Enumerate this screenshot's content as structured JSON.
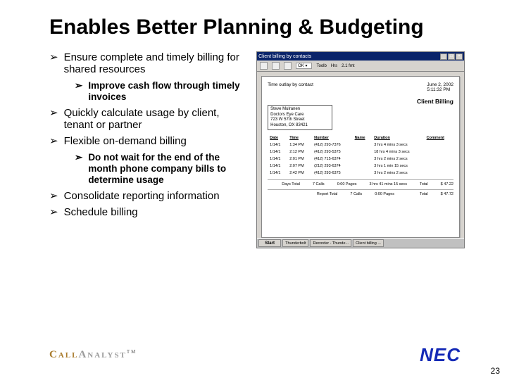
{
  "title": "Enables Better Planning & Budgeting",
  "bullets": {
    "b1": "Ensure complete and timely billing for shared resources",
    "b1_sub1": "Improve cash flow through timely invoices",
    "b2": "Quickly calculate usage by client, tenant or partner",
    "b3": "Flexible on-demand billing",
    "b3_sub1": "Do not wait for the end of the month phone company bills to determine usage",
    "b4": "Consolidate reporting information",
    "b5": "Schedule billing"
  },
  "screenshot": {
    "title": "Client billing by contacts",
    "toolbar": {
      "ok": "OK",
      "tb1": "Toolb",
      "tb2": "Hrs",
      "tb3": "2.1 fmt"
    },
    "paper": {
      "head_left": "Time outlay by contact",
      "head_right_date": "June 2, 2002",
      "head_right_time": "5:11:32 PM",
      "report_title": "Client Billing",
      "client_l1": "Steve Mulranen",
      "client_l2": "Doctors Eye Care",
      "client_l3": "723 W 57th Street",
      "client_l4": "Houston, OX 83421",
      "cols": {
        "c1": "Date",
        "c2": "Time",
        "c3": "Number",
        "c4": "Name",
        "c5": "Duration",
        "c6": "Comment"
      },
      "rows": [
        [
          "1/14/1",
          "1:34 PM",
          "(412) 293-7376",
          "",
          "3 hrs 4 mins 3 secs",
          ""
        ],
        [
          "1/14/1",
          "2:12 PM",
          "(412) 293-5375",
          "",
          "18 hrs 4 mins 3 secs",
          ""
        ],
        [
          "1/14/1",
          "2:01 PM",
          "(412) 715-6374",
          "",
          "3 hrs 2 mins 2 secs",
          ""
        ],
        [
          "1/14/1",
          "2:07 PM",
          "(212) 293-6374",
          "",
          "3 hrs 1 min 15 secs",
          ""
        ],
        [
          "1/14/1",
          "2:42 PM",
          "(412) 293-6375",
          "",
          "3 hrs 2 mins 2 secs",
          ""
        ]
      ],
      "day_total_label": "Days Total",
      "day_total_calls": "7 Calls",
      "day_total_pages": "0:00 Pages",
      "day_total_dur": "3 hrs 41 mins 15 secs",
      "day_total_total_label": "Total",
      "day_total_total_val": "$ 47.22",
      "report_total_label": "Report Total",
      "report_total_calls": "7 Calls",
      "report_total_pages": "0:00 Pages",
      "report_total_total_label": "Total",
      "report_total_total_val": "$ 47.72"
    },
    "taskbar": {
      "start": "Start",
      "t1": "Thunderbolt",
      "t2": "Recorder - Thunde...",
      "t3": "Client billing ...",
      "t4": ""
    }
  },
  "footer": {
    "brand_call": "Call",
    "brand_analyst": "Analyst",
    "tm": "TM",
    "nec": "NEC",
    "page": "23"
  }
}
